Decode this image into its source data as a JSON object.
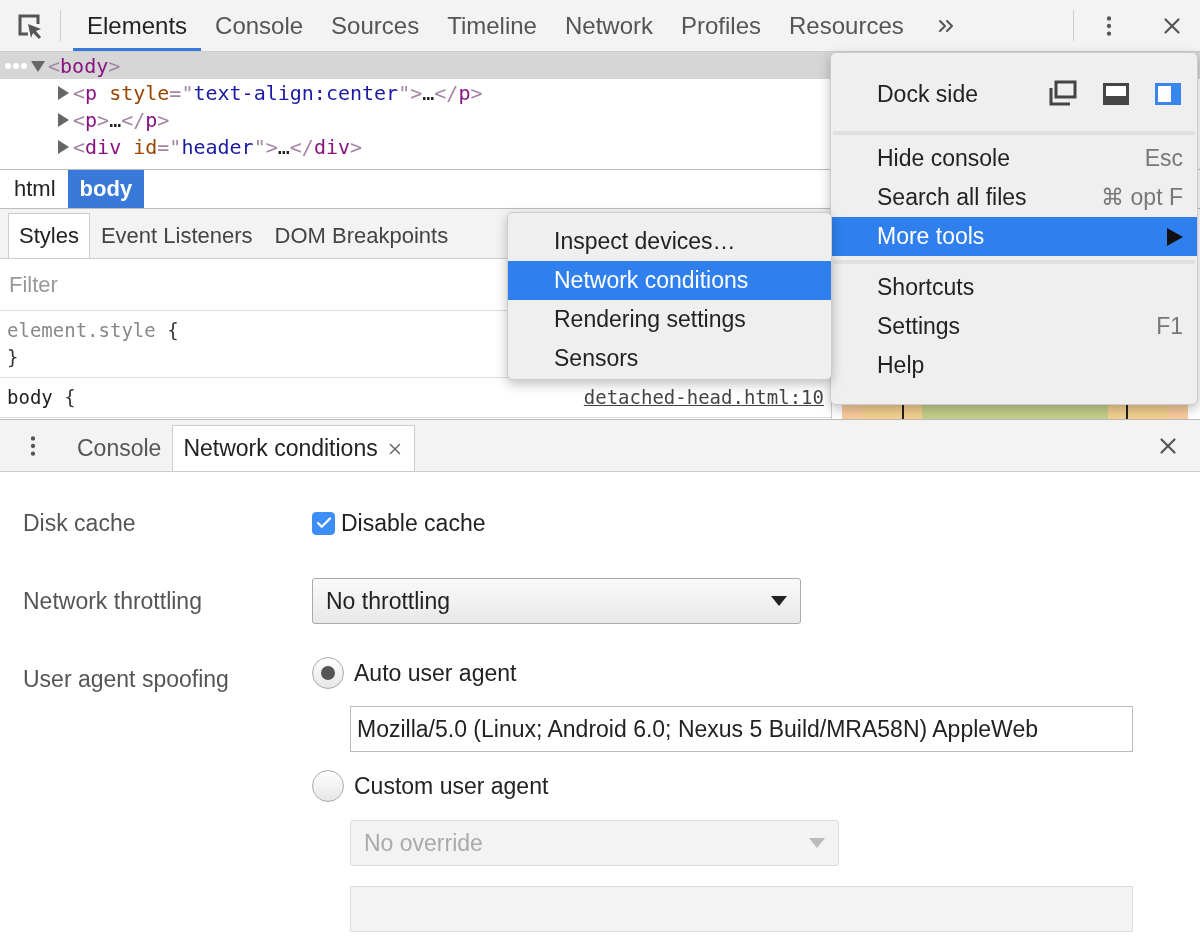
{
  "toolbar": {
    "tabs": [
      {
        "label": "Elements",
        "selected": true
      },
      {
        "label": "Console",
        "selected": false
      },
      {
        "label": "Sources",
        "selected": false
      },
      {
        "label": "Timeline",
        "selected": false
      },
      {
        "label": "Network",
        "selected": false
      },
      {
        "label": "Profiles",
        "selected": false
      },
      {
        "label": "Resources",
        "selected": false
      }
    ]
  },
  "dom_tree": {
    "rows": [
      {
        "selected": true,
        "expanded": true,
        "tokens": [
          {
            "kind": "bracket",
            "text": "<"
          },
          {
            "kind": "name",
            "text": "body"
          },
          {
            "kind": "bracket",
            "text": ">"
          }
        ],
        "children": [
          {
            "selected": false,
            "expanded": false,
            "tokens": [
              {
                "kind": "bracket",
                "text": "<"
              },
              {
                "kind": "name",
                "text": "p"
              },
              {
                "kind": "attr",
                "text": " style"
              },
              {
                "kind": "bracket",
                "text": "=\""
              },
              {
                "kind": "value",
                "text": "text-align:center"
              },
              {
                "kind": "bracket",
                "text": "\">"
              },
              {
                "kind": "text",
                "text": "…"
              },
              {
                "kind": "bracket",
                "text": "</"
              },
              {
                "kind": "name",
                "text": "p"
              },
              {
                "kind": "bracket",
                "text": ">"
              }
            ]
          },
          {
            "selected": false,
            "expanded": false,
            "tokens": [
              {
                "kind": "bracket",
                "text": "<"
              },
              {
                "kind": "name",
                "text": "p"
              },
              {
                "kind": "bracket",
                "text": ">"
              },
              {
                "kind": "text",
                "text": "…"
              },
              {
                "kind": "bracket",
                "text": "</"
              },
              {
                "kind": "name",
                "text": "p"
              },
              {
                "kind": "bracket",
                "text": ">"
              }
            ]
          },
          {
            "selected": false,
            "expanded": false,
            "tokens": [
              {
                "kind": "bracket",
                "text": "<"
              },
              {
                "kind": "name",
                "text": "div"
              },
              {
                "kind": "attr",
                "text": " id"
              },
              {
                "kind": "bracket",
                "text": "=\""
              },
              {
                "kind": "value",
                "text": "header"
              },
              {
                "kind": "bracket",
                "text": "\">"
              },
              {
                "kind": "text",
                "text": "…"
              },
              {
                "kind": "bracket",
                "text": "</"
              },
              {
                "kind": "name",
                "text": "div"
              },
              {
                "kind": "bracket",
                "text": ">"
              }
            ]
          }
        ]
      }
    ]
  },
  "breadcrumbs": [
    {
      "label": "html",
      "selected": false
    },
    {
      "label": "body",
      "selected": true
    }
  ],
  "styles_tabs": [
    {
      "label": "Styles",
      "selected": true
    },
    {
      "label": "Event Listeners",
      "selected": false
    },
    {
      "label": "DOM Breakpoints",
      "selected": false
    }
  ],
  "filter": {
    "placeholder": "Filter"
  },
  "rules": [
    {
      "kind": "inline",
      "selector": "element.style",
      "open": "{",
      "close": "}"
    },
    {
      "kind": "rule",
      "selector": "body",
      "open": "{",
      "source": "detached-head.html:10"
    }
  ],
  "drawer": {
    "tabs": [
      {
        "label": "Console",
        "selected": false,
        "closable": false
      },
      {
        "label": "Network conditions",
        "selected": true,
        "closable": true
      }
    ]
  },
  "network_conditions": {
    "disk_cache": {
      "label": "Disk cache",
      "option": "Disable cache",
      "checked": true
    },
    "throttling": {
      "label": "Network throttling",
      "value": "No throttling"
    },
    "user_agent": {
      "label": "User agent spoofing",
      "options": [
        {
          "label": "Auto user agent",
          "selected": true
        },
        {
          "label": "Custom user agent",
          "selected": false
        }
      ],
      "agent_string": "Mozilla/5.0 (Linux; Android 6.0; Nexus 5 Build/MRA58N) AppleWeb",
      "custom_select": {
        "value": "No override",
        "disabled": true
      },
      "custom_field": {
        "disabled": true
      }
    }
  },
  "main_menu": {
    "dock_label": "Dock side",
    "dock_options": [
      {
        "kind": "undock",
        "selected": false
      },
      {
        "kind": "bottom",
        "selected": false
      },
      {
        "kind": "right",
        "selected": true
      }
    ],
    "groups": [
      [
        {
          "label": "Hide console",
          "shortcut": "Esc",
          "selected": false,
          "submenu": false
        },
        {
          "label": "Search all files",
          "shortcut": "⌘ opt F",
          "selected": false,
          "submenu": false
        },
        {
          "label": "More tools",
          "selected": true,
          "submenu": true
        }
      ],
      [
        {
          "label": "Shortcuts",
          "selected": false,
          "submenu": false
        },
        {
          "label": "Settings",
          "shortcut": "F1",
          "selected": false,
          "submenu": false
        },
        {
          "label": "Help",
          "selected": false,
          "submenu": false
        }
      ]
    ]
  },
  "submenu": {
    "items": [
      {
        "label": "Inspect devices…",
        "selected": false
      },
      {
        "label": "Network conditions",
        "selected": true
      },
      {
        "label": "Rendering settings",
        "selected": false
      },
      {
        "label": "Sensors",
        "selected": false
      }
    ]
  }
}
